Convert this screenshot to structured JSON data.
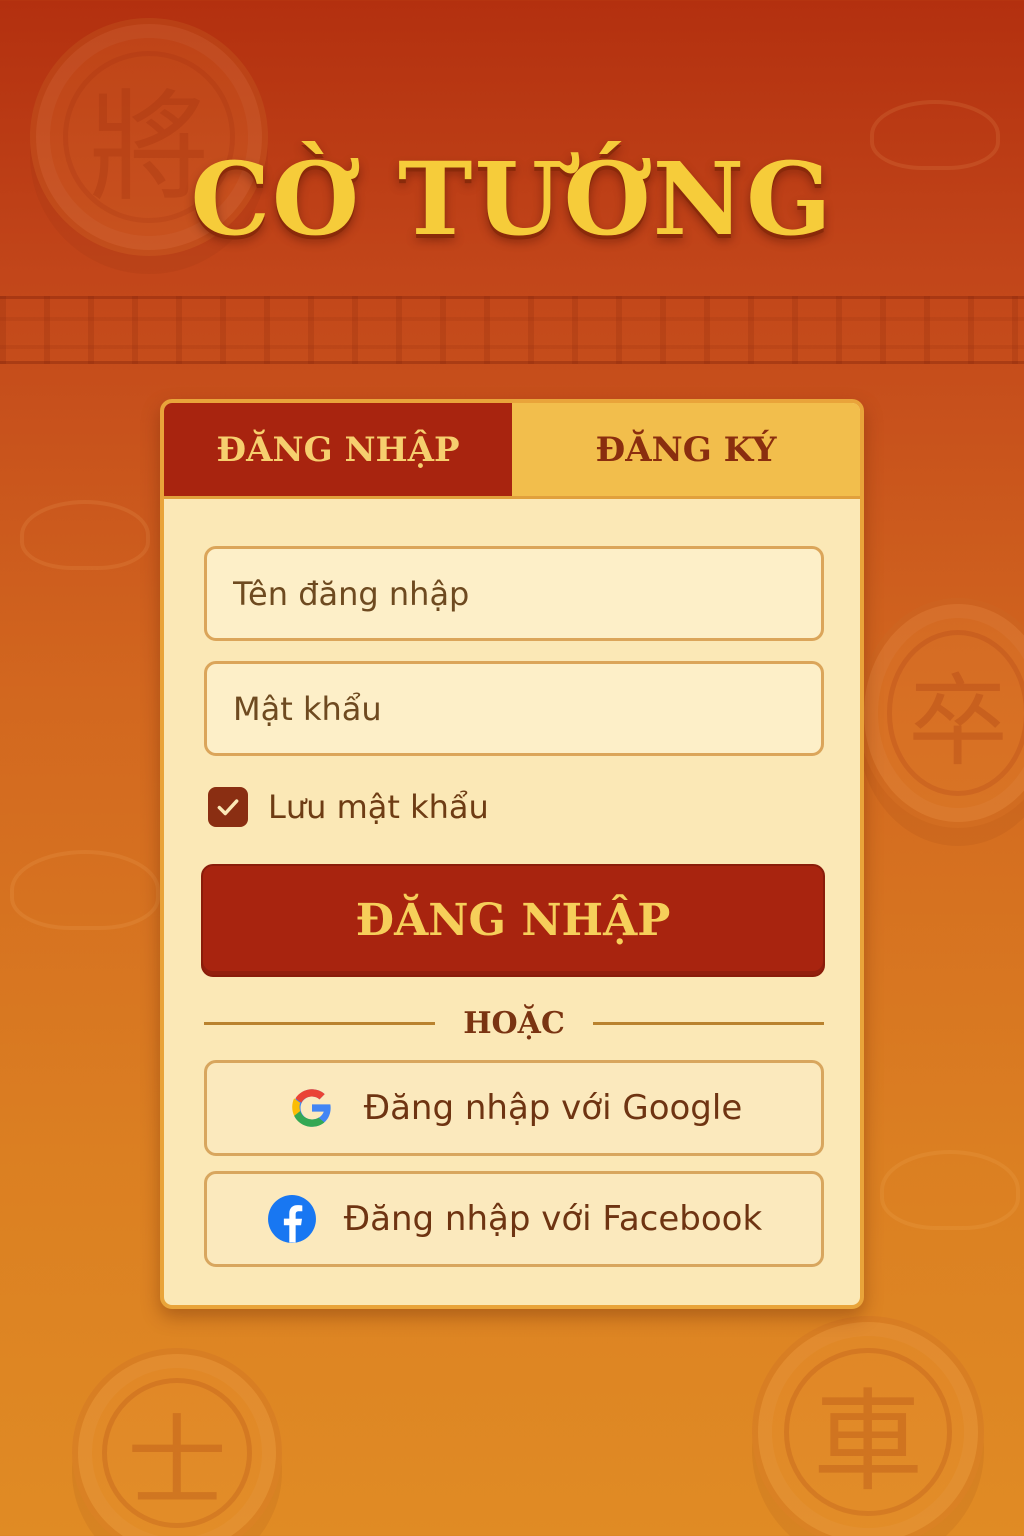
{
  "app": {
    "title": "CỜ TƯỚNG"
  },
  "background": {
    "pieces": [
      "將",
      "卒",
      "士",
      "車"
    ]
  },
  "tabs": [
    {
      "label": "ĐĂNG NHẬP",
      "active": true
    },
    {
      "label": "ĐĂNG KÝ",
      "active": false
    }
  ],
  "form": {
    "username": {
      "placeholder": "Tên đăng nhập",
      "value": ""
    },
    "password": {
      "placeholder": "Mật khẩu",
      "value": ""
    },
    "remember": {
      "label": "Lưu mật khẩu",
      "checked": true
    },
    "submit_label": "ĐĂNG NHẬP",
    "divider_label": "HOẶC"
  },
  "social": {
    "google": {
      "label": "Đăng nhập với Google",
      "icon": "google-icon"
    },
    "facebook": {
      "label": "Đăng nhập với Facebook",
      "icon": "facebook-icon"
    }
  },
  "colors": {
    "primary_red": "#a8240f",
    "gold": "#f6cc3a",
    "card_bg": "#fbe8b6",
    "tab_inactive": "#f2be4c"
  }
}
